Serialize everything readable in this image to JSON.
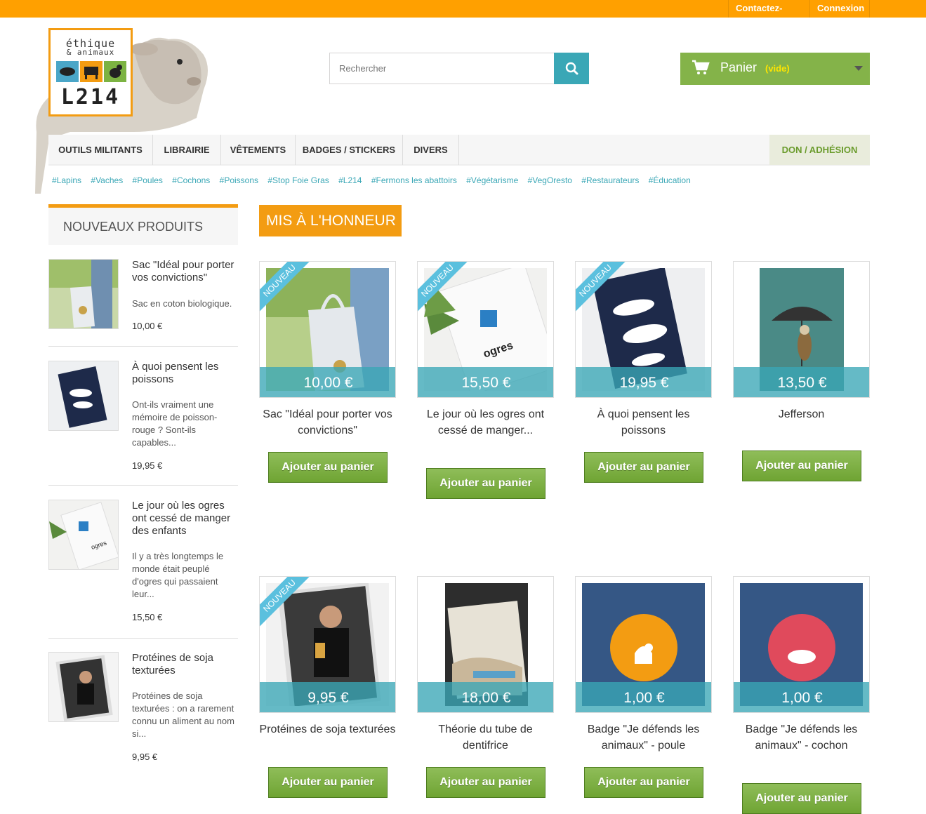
{
  "topbar": {
    "contact": "Contactez-nous",
    "login": "Connexion"
  },
  "logo": {
    "line1": "éthique",
    "line2": "& animaux",
    "brand": "L214"
  },
  "search": {
    "placeholder": "Rechercher"
  },
  "cart": {
    "label": "Panier",
    "status": "(vide)"
  },
  "nav": {
    "items": [
      "OUTILS MILITANTS",
      "LIBRAIRIE",
      "VÊTEMENTS",
      "BADGES / STICKERS",
      "DIVERS"
    ],
    "don": "DON / ADHÉSION"
  },
  "tags": [
    "#Lapins",
    "#Vaches",
    "#Poules",
    "#Cochons",
    "#Poissons",
    "#Stop Foie Gras",
    "#L214",
    "#Fermons les abattoirs",
    "#Végétarisme",
    "#VegOresto",
    "#Restaurateurs",
    "#Éducation"
  ],
  "sidebar": {
    "title": "NOUVEAUX PRODUITS",
    "items": [
      {
        "name": "Sac \"Idéal pour porter vos convictions\"",
        "desc": "Sac en coton biologique.",
        "price": "10,00 €"
      },
      {
        "name": "À quoi pensent les poissons",
        "desc": "Ont-ils vraiment une mémoire de poisson-rouge ? Sont-ils capables...",
        "price": "19,95 €"
      },
      {
        "name": "Le jour où les ogres ont cessé de manger des enfants",
        "desc": "Il y a très longtemps le monde était peuplé d'ogres qui passaient leur...",
        "price": "15,50 €"
      },
      {
        "name": "Protéines de soja texturées",
        "desc": "Protéines de soja texturées : on a  rarement connu un aliment au nom si...",
        "price": "9,95 €"
      }
    ]
  },
  "featured": {
    "title": "MIS À L'HONNEUR",
    "ribbon": "NOUVEAU",
    "add_label": "Ajouter au panier"
  },
  "products": [
    {
      "title": "Sac \"Idéal pour porter vos convictions\"",
      "price": "10,00 €",
      "new": true
    },
    {
      "title": "Le jour où les ogres ont cessé de manger...",
      "price": "15,50 €",
      "new": true
    },
    {
      "title": "À quoi pensent les poissons",
      "price": "19,95 €",
      "new": true
    },
    {
      "title": "Jefferson",
      "price": "13,50 €",
      "new": false
    },
    {
      "title": "Protéines de soja texturées",
      "price": "9,95 €",
      "new": true
    },
    {
      "title": "Théorie du tube de dentifrice",
      "price": "18,00 €",
      "new": false
    },
    {
      "title": "Badge \"Je défends les animaux\" - poule",
      "price": "1,00 €",
      "new": false
    },
    {
      "title": "Badge \"Je défends les animaux\" - cochon",
      "price": "1,00 €",
      "new": false
    }
  ],
  "colors": {
    "orange": "#ffa000",
    "teal": "#3aa7b6",
    "green": "#84b349"
  }
}
